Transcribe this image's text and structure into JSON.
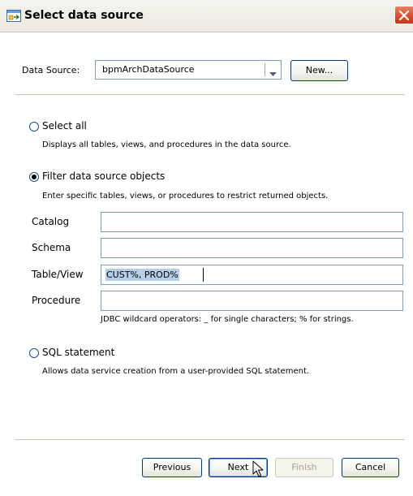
{
  "window": {
    "title": "Select data source"
  },
  "data_source": {
    "label": "Data Source:",
    "selected_value": "bpmArchDataSource",
    "new_button": "New..."
  },
  "options": {
    "select_all": {
      "label": "Select all",
      "description": "Displays all tables, views, and procedures in the data source.",
      "selected": false
    },
    "filter": {
      "label": "Filter data source objects",
      "description": "Enter specific tables, views, or procedures to restrict returned objects.",
      "selected": true
    },
    "sql": {
      "label": "SQL statement",
      "description": "Allows data service creation from a user-provided SQL statement.",
      "selected": false
    }
  },
  "filter_fields": {
    "catalog": {
      "label": "Catalog",
      "value": ""
    },
    "schema": {
      "label": "Schema",
      "value": ""
    },
    "table_view": {
      "label": "Table/View",
      "value": "CUST%, PROD%"
    },
    "procedure": {
      "label": "Procedure",
      "value": ""
    },
    "hint": "JDBC wildcard operators: _ for single characters; % for strings."
  },
  "buttons": {
    "previous": "Previous",
    "next": "Next",
    "finish": "Finish",
    "cancel": "Cancel"
  },
  "colors": {
    "titlebar": "#ebe9e0",
    "close_button": "#d64a2a",
    "text_selection": "#b5cde8",
    "input_border": "#7f9db9"
  }
}
